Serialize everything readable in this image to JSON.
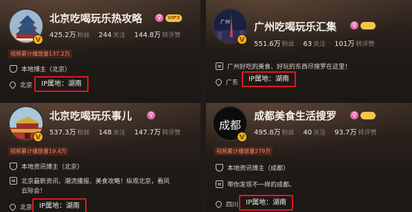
{
  "cards": [
    {
      "name": "北京吃喝玩乐热攻略",
      "vip_label": "VIP3",
      "fans": "425.2万",
      "fans_label": "粉丝",
      "follow": "244",
      "follow_label": "关注",
      "likes": "144.8万",
      "likes_label": "转评赞",
      "play_count": "视频累计播放量137.2万",
      "role": "本地博主（北京）",
      "location": "北京",
      "ip": "IP属地：湖南"
    },
    {
      "name": "广州吃喝玩乐汇集",
      "avatar_text": "广州",
      "fans": "551.6万",
      "fans_label": "粉丝",
      "follow": "63",
      "follow_label": "关注",
      "likes": "101万",
      "likes_label": "转评赞",
      "desc": "广州好吃的美食、好玩的东西尽搜罗在这里！",
      "location": "广东",
      "ip": "IP属地：湖南"
    },
    {
      "name": "北京吃喝玩乐事儿",
      "fans": "537.3万",
      "fans_label": "粉丝",
      "follow": "148",
      "follow_label": "关注",
      "likes": "147.7万",
      "likes_label": "转评赞",
      "play_count": "视频累计播放量19.4万",
      "role": "本地资讯博主（北京）",
      "desc_line1": "北京最新资讯、潮流播报、美食攻略！纵观北京，看风",
      "desc_line2": "云际会！",
      "location": "北京",
      "ip": "IP属地：湖南"
    },
    {
      "name": "成都美食生活搜罗",
      "avatar_text": "成都",
      "fans": "495.8万",
      "fans_label": "粉丝",
      "follow": "40",
      "follow_label": "关注",
      "likes": "93.7万",
      "likes_label": "转评赞",
      "play_count": "视频累计播放量279万",
      "role": "本地资讯博主（成都）",
      "desc": "带你发现不一样的成都。",
      "location": "四川",
      "ip": "IP属地：湖南"
    }
  ],
  "badge_v": "V",
  "gender_symbol": "♀",
  "colors": {
    "highlight": "#e0191e",
    "badge": "#f0b21f",
    "play": "#ee8a6a"
  }
}
